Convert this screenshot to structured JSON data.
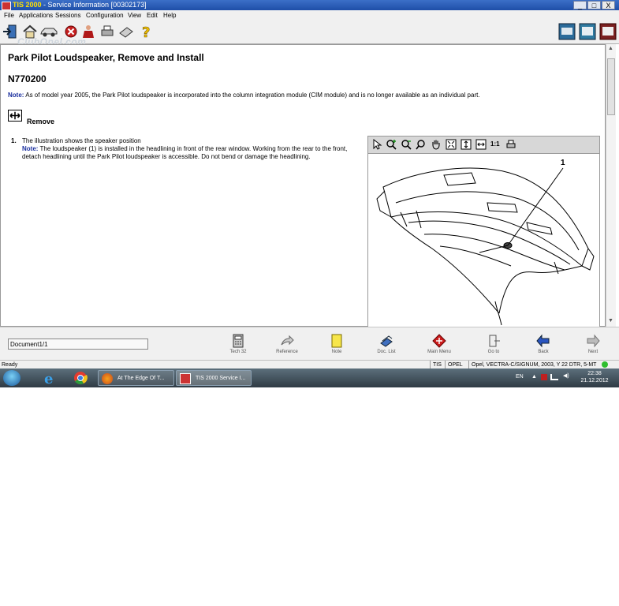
{
  "window": {
    "app_name": "TIS 2000",
    "title_rest": " - Service Information [00302173]",
    "minimize": "_",
    "maximize": "□",
    "close": "X"
  },
  "menu": [
    "File",
    "Applications",
    "Sessions",
    "Configuration",
    "View",
    "Edit",
    "Help"
  ],
  "watermark": "ClubOpel.com",
  "document": {
    "title": "Park Pilot Loudspeaker, Remove and Install",
    "number": "N770200",
    "note_label": "Note:",
    "note_text": "As of model year 2005, the Park Pilot loudspeaker is incorporated into the column integration module (CIM module) and is no longer available as an individual part.",
    "section_label": "Remove",
    "step_number": "1.",
    "step_text": "The illustration shows the speaker position",
    "step_note_label": "Note:",
    "step_note_text": "The loudspeaker (1) is installed in the headlining in front of the rear window. Working from the rear to the front, detach headlining until the Park Pilot loudspeaker is accessible. Do not bend or damage the headlining."
  },
  "viewer": {
    "zoom_label": "1:1",
    "callout": "1"
  },
  "bottom": {
    "doc_position": "Document1/1",
    "nav": [
      "Tech 32",
      "Reference",
      "Note",
      "Doc. List",
      "Main Menu",
      "Go to",
      "Back",
      "Next"
    ]
  },
  "status": {
    "ready": "Ready",
    "field1": "TIS",
    "field2": "OPEL",
    "field3": "Opel, VECTRA-C/SIGNUM, 2003, Y 22 DTR, 5-MT"
  },
  "taskbar": {
    "app1": "At The Edge Of T...",
    "app2": "TIS 2000 Service I...",
    "lang": "EN",
    "time": "22:38",
    "date": "21.12.2012"
  },
  "colors": {
    "titlebar": "#1f4fa8",
    "note_label": "#1a2f9e",
    "main_menu_icon": "#cc1d1d"
  }
}
